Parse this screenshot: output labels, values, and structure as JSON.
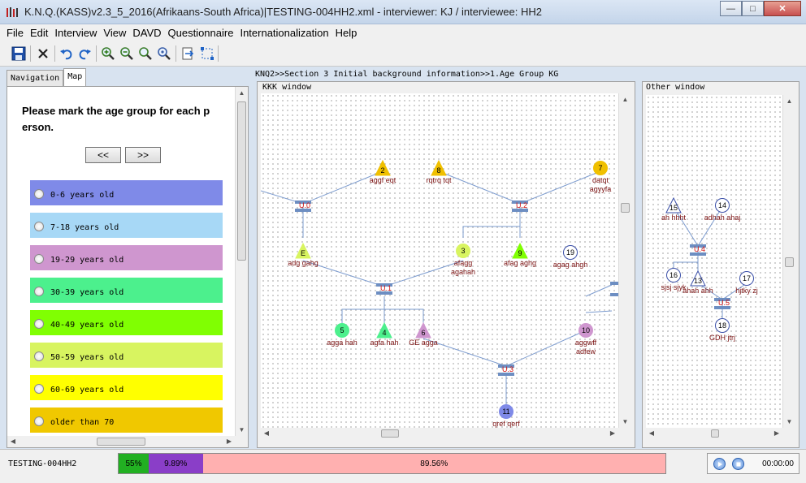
{
  "window": {
    "title": "K.N.Q.(KASS)v2.3_5_2016(Afrikaans-South Africa)|TESTING-004HH2.xml - interviewer: KJ / interviewee: HH2",
    "minimize": "—",
    "maximize": "□",
    "close": "✕"
  },
  "menu": [
    "File",
    "Edit",
    "Interview",
    "View",
    "DAVD",
    "Questionnaire",
    "Internationalization",
    "Help"
  ],
  "toolbar": {
    "icons": [
      "save-icon",
      "close-icon",
      "undo-icon",
      "redo-icon",
      "zoom-in-icon",
      "zoom-out-icon",
      "zoom-fit-icon",
      "zoom-reset-icon",
      "export-icon",
      "select-icon"
    ]
  },
  "left_panel": {
    "tabs": [
      "Navigation",
      "Map"
    ],
    "active_tab": "Map",
    "question": "Please mark the age group for each p erson.",
    "prev_button": "<<",
    "next_button": ">>",
    "options": [
      {
        "label": "0-6 years old",
        "color": "#7f8ae8"
      },
      {
        "label": "7-18 years old",
        "color": "#a7d8f6"
      },
      {
        "label": "19-29 years old",
        "color": "#cf96cf"
      },
      {
        "label": "30-39 years old",
        "color": "#4cf08d"
      },
      {
        "label": "40-49 years old",
        "color": "#80ff02"
      },
      {
        "label": "50-59 years old",
        "color": "#d8f460"
      },
      {
        "label": "60-69 years old",
        "color": "#ffff00"
      },
      {
        "label": "older than 70",
        "color": "#f0c800"
      }
    ]
  },
  "breadcrumb": "KNQ2>>Section 3 Initial background information>>1.Age Group KG",
  "kkk_window": {
    "title": "KKK window",
    "persons": [
      {
        "id": "2",
        "name": "aggf eqt",
        "shape": "triangle",
        "color": "#f0c000"
      },
      {
        "id": "8",
        "name": "rqtrq tqt",
        "shape": "triangle",
        "color": "#f0c000"
      },
      {
        "id": "7",
        "name": "datqt",
        "name2": "agyyfa",
        "shape": "circle",
        "color": "#f0c000"
      },
      {
        "id": "E",
        "name": "adg gahg",
        "shape": "triangle",
        "color": "#d8f460"
      },
      {
        "id": "3",
        "name": "afagg",
        "name2": "agahah",
        "shape": "circle",
        "color": "#d8f460"
      },
      {
        "id": "9",
        "name": "afag aghg",
        "shape": "triangle",
        "color": "#80ff02"
      },
      {
        "id": "19",
        "name": "agag ahgh",
        "shape": "circle",
        "color": "#ffffff"
      },
      {
        "id": "5",
        "name": "agga hah",
        "shape": "circle",
        "color": "#4cf08d"
      },
      {
        "id": "4",
        "name": "agfa hah",
        "shape": "triangle",
        "color": "#4cf08d"
      },
      {
        "id": "6",
        "name": "GE agga",
        "shape": "triangle",
        "color": "#cf96cf"
      },
      {
        "id": "10",
        "name": "aggwff",
        "name2": "adfew",
        "shape": "circle",
        "color": "#cf96cf"
      },
      {
        "id": "11",
        "name": "qref qerf",
        "shape": "circle",
        "color": "#7f8ae8"
      }
    ],
    "unions": [
      "U.0",
      "U.2",
      "U.1",
      "U.3"
    ]
  },
  "other_window": {
    "title": "Other window",
    "persons": [
      {
        "id": "15",
        "name": "ah hhht",
        "shape": "triangle",
        "color": "#ffffff"
      },
      {
        "id": "14",
        "name": "adhah ahaj",
        "shape": "circle",
        "color": "#ffffff"
      },
      {
        "id": "16",
        "name": "sjsj sjyk",
        "shape": "circle",
        "color": "#ffffff"
      },
      {
        "id": "13",
        "name": "ahah ahh",
        "shape": "triangle",
        "color": "#ffffff"
      },
      {
        "id": "17",
        "name": "hjtky zj",
        "shape": "circle",
        "color": "#ffffff"
      },
      {
        "id": "18",
        "name": "GDH jtrj",
        "shape": "circle",
        "color": "#ffffff"
      }
    ],
    "unions": [
      "U.4",
      "U.5"
    ]
  },
  "status": {
    "file": "TESTING-004HH2",
    "progress": [
      {
        "label": "55%",
        "value": 5.5,
        "color": "#22b022"
      },
      {
        "label": "9.89%",
        "value": 9.89,
        "color": "#8a3ec8"
      },
      {
        "label": "89.56%",
        "value": 84.61,
        "color": "#ffb0b0"
      }
    ],
    "time": "00:00:00"
  }
}
